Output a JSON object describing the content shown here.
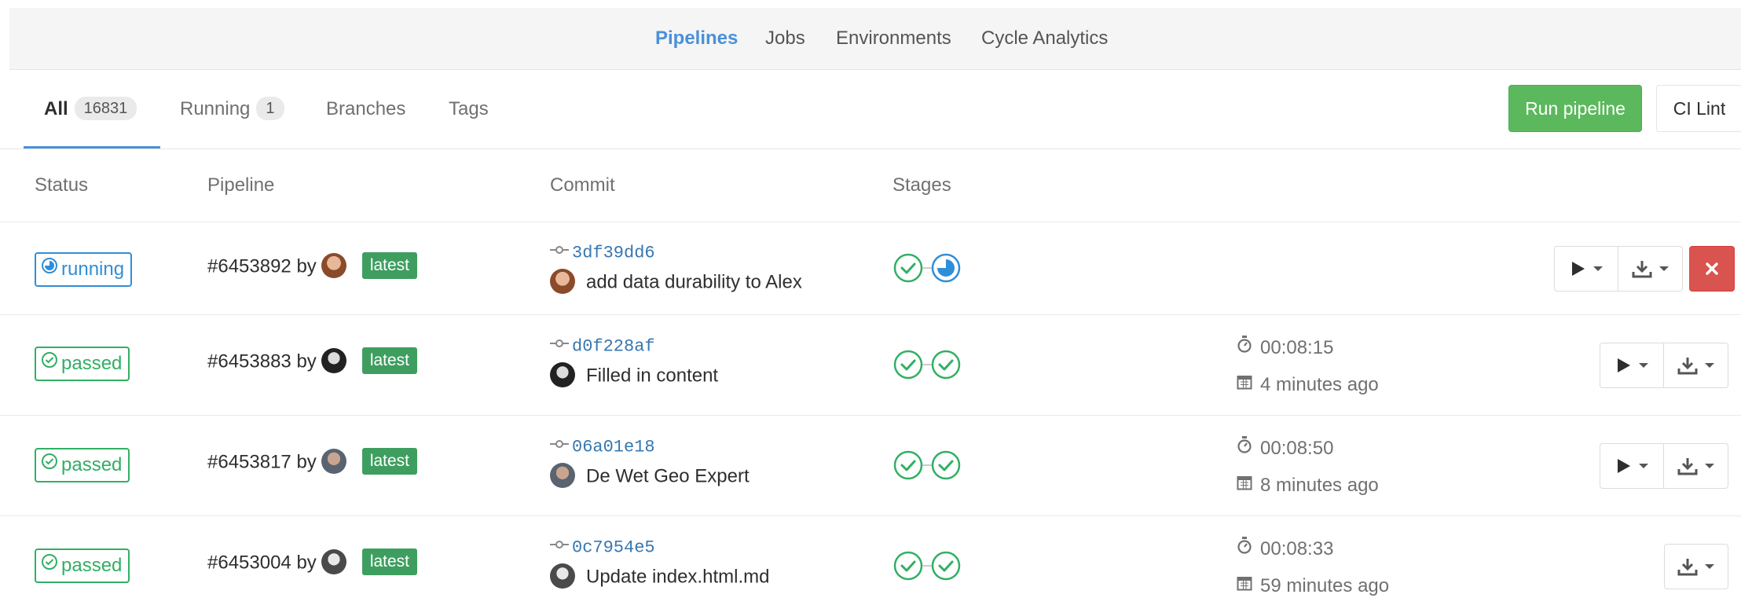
{
  "subnav": {
    "items": [
      "Pipelines",
      "Jobs",
      "Environments",
      "Cycle Analytics"
    ],
    "active": "Pipelines"
  },
  "tabs": [
    {
      "label": "All",
      "count": "16831"
    },
    {
      "label": "Running",
      "count": "1"
    },
    {
      "label": "Branches"
    },
    {
      "label": "Tags"
    }
  ],
  "actions": {
    "run_pipeline": "Run pipeline",
    "ci_lint": "CI Lint"
  },
  "table": {
    "headers": {
      "status": "Status",
      "pipeline": "Pipeline",
      "commit": "Commit",
      "stages": "Stages"
    },
    "rows": [
      {
        "status": "running",
        "pipeline_id": "#6453892",
        "by": "by",
        "label": "latest",
        "sha": "3df39dd6",
        "message": "add data durability to Alex",
        "stages": [
          "passed",
          "running"
        ],
        "duration": "",
        "finished": "",
        "actions": [
          "play",
          "download",
          "cancel"
        ]
      },
      {
        "status": "passed",
        "pipeline_id": "#6453883",
        "by": "by",
        "label": "latest",
        "sha": "d0f228af",
        "message": "Filled in content",
        "stages": [
          "passed",
          "passed"
        ],
        "duration": "00:08:15",
        "finished": "4 minutes ago",
        "actions": [
          "play",
          "download"
        ]
      },
      {
        "status": "passed",
        "pipeline_id": "#6453817",
        "by": "by",
        "label": "latest",
        "sha": "06a01e18",
        "message": "De Wet Geo Expert",
        "stages": [
          "passed",
          "passed"
        ],
        "duration": "00:08:50",
        "finished": "8 minutes ago",
        "actions": [
          "play",
          "download"
        ]
      },
      {
        "status": "passed",
        "pipeline_id": "#6453004",
        "by": "by",
        "label": "latest",
        "sha": "0c7954e5",
        "message": "Update index.html.md",
        "stages": [
          "passed",
          "passed"
        ],
        "duration": "00:08:33",
        "finished": "59 minutes ago",
        "actions": [
          "download"
        ]
      }
    ]
  },
  "colors": {
    "accent": "#4a90d9",
    "running": "#2f8ed8",
    "passed": "#31af64",
    "latest_label": "#3e9e5f",
    "run_button": "#5cb85c",
    "cancel_button": "#d9534f",
    "sha_link": "#3777b0"
  },
  "icons": {
    "status_running": "running-status-icon",
    "status_passed": "check-circle-icon",
    "commit": "commit-icon",
    "duration": "stopwatch-icon",
    "finished": "calendar-icon",
    "play": "play-icon",
    "download": "download-icon",
    "cancel": "close-icon"
  }
}
